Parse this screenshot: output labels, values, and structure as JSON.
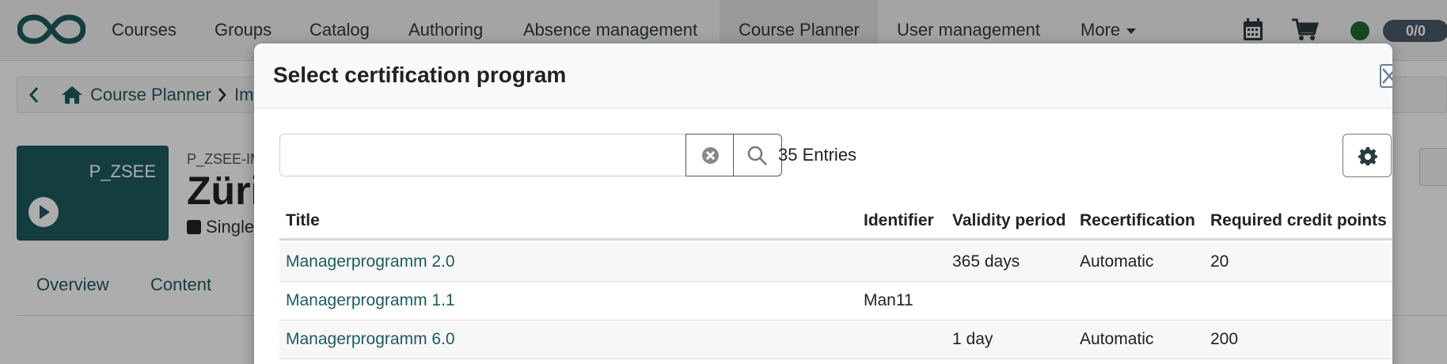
{
  "nav": {
    "items": [
      "Courses",
      "Groups",
      "Catalog",
      "Authoring",
      "Absence management",
      "Course Planner",
      "User management",
      "More"
    ],
    "active": "Course Planner",
    "counter": "0/0"
  },
  "background": {
    "breadcrumb": [
      "Course Planner",
      "Im"
    ],
    "tile_label": "P_ZSEE",
    "course_ext": "P_ZSEE-IM",
    "course_title": "Züri",
    "course_type": "Single",
    "tabs": [
      "Overview",
      "Content"
    ]
  },
  "modal": {
    "title": "Select certification program",
    "search": {
      "value": "",
      "placeholder": ""
    },
    "entries": "35 Entries",
    "table": {
      "headers": [
        "Title",
        "Identifier",
        "Validity period",
        "Recertification",
        "Required credit points"
      ],
      "rows": [
        [
          "Managerprogramm 2.0",
          "",
          "365 days",
          "Automatic",
          "20"
        ],
        [
          "Managerprogramm 1.1",
          "Man11",
          "",
          "",
          ""
        ],
        [
          "Managerprogramm 6.0",
          "",
          "1 day",
          "Automatic",
          "200"
        ]
      ]
    }
  },
  "colors": {
    "brand": "#1e5b5e",
    "status_online": "#1f6b2e",
    "counter_bg": "#4c5b66"
  },
  "icons": [
    "infinity-logo-icon",
    "calendar-icon",
    "cart-icon",
    "status-dot-icon",
    "back-icon",
    "home-icon",
    "play-icon",
    "share-icon",
    "close-icon",
    "clear-search-icon",
    "search-icon",
    "gear-icon"
  ]
}
